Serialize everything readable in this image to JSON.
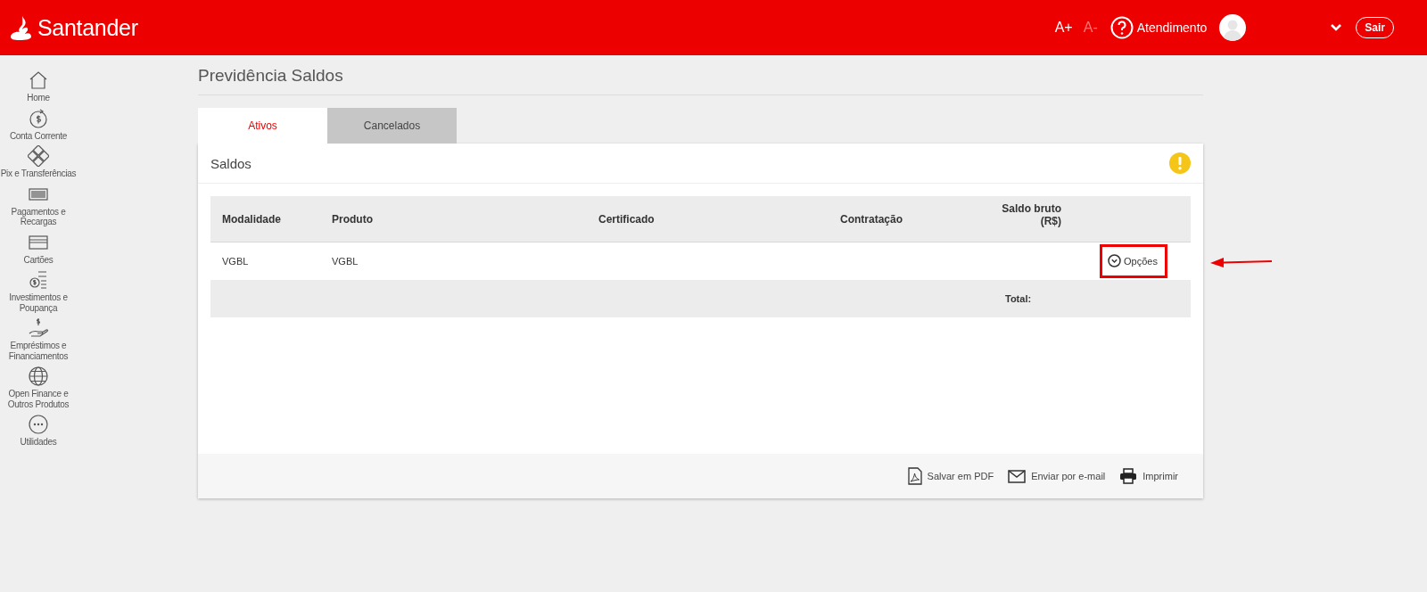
{
  "header": {
    "brand": "Santander",
    "font_larger": "A+",
    "font_smaller": "A-",
    "help": "Atendimento",
    "logout": "Sair"
  },
  "sidebar": {
    "items": [
      {
        "label": "Home"
      },
      {
        "label": "Conta Corrente"
      },
      {
        "label": "Pix e Transferências"
      },
      {
        "label": "Pagamentos e Recargas"
      },
      {
        "label": "Cartões"
      },
      {
        "label": "Investimentos e Poupança"
      },
      {
        "label": "Empréstimos e Financiamentos"
      },
      {
        "label": "Open Finance e Outros Produtos"
      },
      {
        "label": "Utilidades"
      }
    ]
  },
  "page": {
    "title": "Previdência Saldos"
  },
  "tabs": [
    {
      "label": "Ativos",
      "selected": true
    },
    {
      "label": "Cancelados",
      "selected": false
    }
  ],
  "card": {
    "title": "Saldos"
  },
  "table": {
    "columns": [
      "Modalidade",
      "Produto",
      "Certificado",
      "Contratação",
      "Saldo bruto (R$)"
    ],
    "rows": [
      {
        "cells": [
          "VGBL",
          "VGBL",
          "",
          "",
          ""
        ],
        "action": "Opções"
      }
    ],
    "total_label": "Total:"
  },
  "footer_actions": [
    "Salvar em PDF",
    "Enviar por e-mail",
    "Imprimir"
  ]
}
